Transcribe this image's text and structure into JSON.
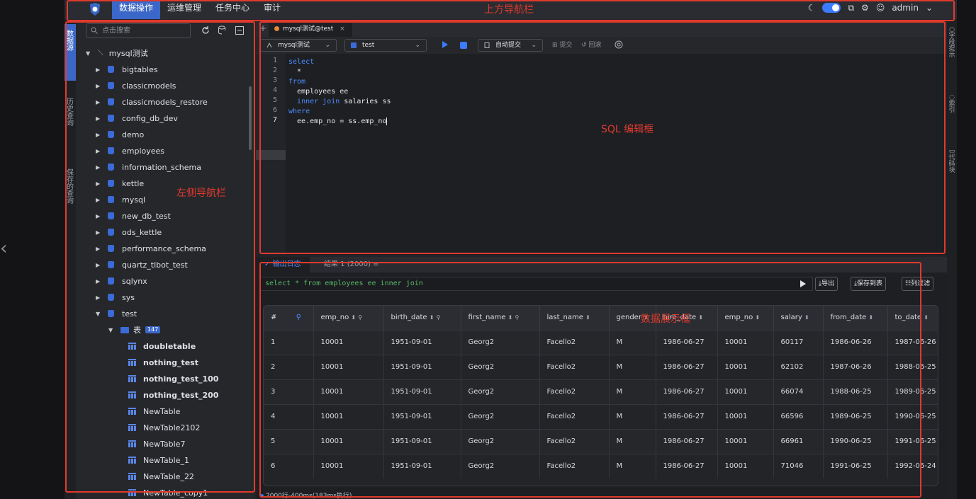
{
  "topnav": {
    "menu": [
      "数据操作",
      "运维管理",
      "任务中心",
      "审计"
    ],
    "user": "admin"
  },
  "vtabs": [
    "数据源",
    "历史查询",
    "保存的查询"
  ],
  "rtabs": [
    "字段提示",
    "索引",
    "代码块"
  ],
  "sidebar": {
    "search_placeholder": "点击搜索",
    "root": "mysql测试",
    "databases": [
      "bigtables",
      "classicmodels",
      "classicmodels_restore",
      "config_db_dev",
      "demo",
      "employees",
      "information_schema",
      "kettle",
      "mysql",
      "new_db_test",
      "ods_kettle",
      "performance_schema",
      "quartz_tlbot_test",
      "sqlynx",
      "sys",
      "test"
    ],
    "folder": "表",
    "folder_count": "147",
    "tables": [
      "doubletable",
      "nothing_test",
      "nothing_test_100",
      "nothing_test_200",
      "NewTable",
      "NewTable2102",
      "NewTable7",
      "NewTable_1",
      "NewTable_22",
      "NewTable_copy1"
    ],
    "bold_tables": [
      true,
      true,
      true,
      true,
      false,
      false,
      false,
      false,
      false,
      false
    ]
  },
  "editor": {
    "tab_title": "mysql测试@test",
    "connection": "mysql测试",
    "database": "test",
    "autocommit": "自动提交",
    "commit": "提交",
    "rollback": "回滚",
    "line_numbers": [
      "1",
      "2",
      "3",
      "4",
      "5",
      "6",
      "7"
    ],
    "current_line": 7
  },
  "results": {
    "tab_log": "输出日志",
    "tab_result": "结果 1 (2000)",
    "sql": "select * from employees ee inner join",
    "export": "导出",
    "save_table": "保存到表",
    "filter": "列过滤",
    "columns": [
      "#",
      "emp_no",
      "birth_date",
      "first_name",
      "last_name",
      "gender",
      "hire_date",
      "emp_no",
      "salary",
      "from_date",
      "to_date"
    ],
    "rows": [
      [
        "1",
        "10001",
        "1951-09-01",
        "Georg2",
        "Facello2",
        "M",
        "1986-06-27",
        "10001",
        "60117",
        "1986-06-26",
        "1987-06-26"
      ],
      [
        "2",
        "10001",
        "1951-09-01",
        "Georg2",
        "Facello2",
        "M",
        "1986-06-27",
        "10001",
        "62102",
        "1987-06-26",
        "1988-06-25"
      ],
      [
        "3",
        "10001",
        "1951-09-01",
        "Georg2",
        "Facello2",
        "M",
        "1986-06-27",
        "10001",
        "66074",
        "1988-06-25",
        "1989-06-25"
      ],
      [
        "4",
        "10001",
        "1951-09-01",
        "Georg2",
        "Facello2",
        "M",
        "1986-06-27",
        "10001",
        "66596",
        "1989-06-25",
        "1990-06-25"
      ],
      [
        "5",
        "10001",
        "1951-09-01",
        "Georg2",
        "Facello2",
        "M",
        "1986-06-27",
        "10001",
        "66961",
        "1990-06-25",
        "1991-06-25"
      ],
      [
        "6",
        "10001",
        "1951-09-01",
        "Georg2",
        "Facello2",
        "M",
        "1986-06-27",
        "10001",
        "71046",
        "1991-06-25",
        "1992-06-24"
      ]
    ],
    "status": "2000行-400ms(183ms执行)"
  },
  "annotations": {
    "top": "上方导航栏",
    "left": "左侧导航栏",
    "editor": "SQL 编辑框",
    "data": "数据展示框"
  },
  "colors": {
    "accent": "#3b68c8",
    "annotation": "#e03a2e",
    "keyword": "#4d8cff"
  }
}
